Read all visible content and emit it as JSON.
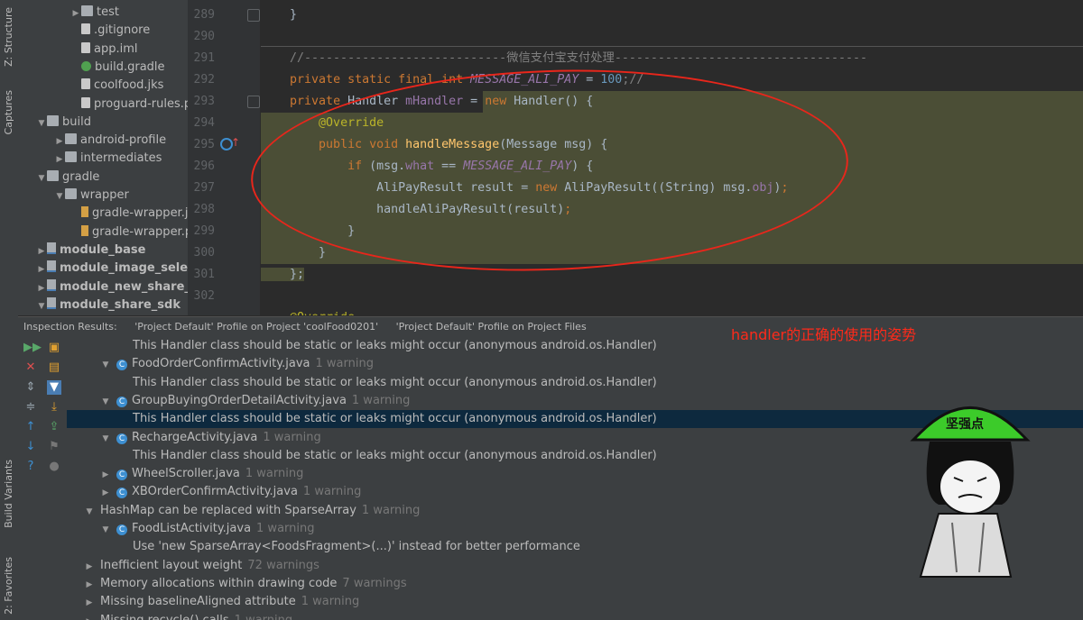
{
  "left_stripe": {
    "structure_tab": "Z: Structure",
    "captures_tab": "Captures",
    "build_variants_tab": "Build Variants",
    "favorites_tab": "2: Favorites"
  },
  "project_tree": [
    {
      "label": "test",
      "type": "folder",
      "arrow": "▶"
    },
    {
      "label": ".gitignore",
      "type": "file",
      "arrow": ""
    },
    {
      "label": "app.iml",
      "type": "file",
      "arrow": ""
    },
    {
      "label": "build.gradle",
      "type": "gradle",
      "arrow": ""
    },
    {
      "label": "coolfood.jks",
      "type": "file",
      "arrow": ""
    },
    {
      "label": "proguard-rules.pro",
      "type": "file",
      "arrow": ""
    },
    {
      "label": "build",
      "type": "folder",
      "arrow": "▼"
    },
    {
      "label": "android-profile",
      "type": "folder",
      "arrow": "▶"
    },
    {
      "label": "intermediates",
      "type": "folder",
      "arrow": "▶"
    },
    {
      "label": "gradle",
      "type": "folder",
      "arrow": "▼"
    },
    {
      "label": "wrapper",
      "type": "folder",
      "arrow": "▼"
    },
    {
      "label": "gradle-wrapper.jar",
      "type": "jar",
      "arrow": ""
    },
    {
      "label": "gradle-wrapper.properties",
      "type": "jar",
      "arrow": ""
    },
    {
      "label": "module_base",
      "type": "module",
      "arrow": "▶"
    },
    {
      "label": "module_image_selector",
      "type": "module",
      "arrow": "▶"
    },
    {
      "label": "module_new_share_sdk",
      "type": "module",
      "arrow": "▶"
    },
    {
      "label": "module_share_sdk",
      "type": "module",
      "arrow": "▼"
    }
  ],
  "editor": {
    "line_numbers": [
      "289",
      "290",
      "291",
      "292",
      "293",
      "294",
      "295",
      "296",
      "297",
      "298",
      "299",
      "300",
      "301",
      "302"
    ],
    "comment_text": "微信支付宝支付处理"
  },
  "inspection": {
    "header_label": "Inspection Results:",
    "tab1": "'Project Default' Profile on Project 'coolFood0201'",
    "tab2": "'Project Default' Profile on Project Files",
    "rows": [
      {
        "indent": 73,
        "arrow": "",
        "icon": false,
        "text": "This Handler class should be static or leaks might occur (anonymous android.os.Handler)",
        "warn": "",
        "selected": false
      },
      {
        "indent": 37,
        "arrow": "▼",
        "icon": true,
        "text": "FoodOrderConfirmActivity.java",
        "warn": "1 warning",
        "selected": false
      },
      {
        "indent": 73,
        "arrow": "",
        "icon": false,
        "text": "This Handler class should be static or leaks might occur (anonymous android.os.Handler)",
        "warn": "",
        "selected": false
      },
      {
        "indent": 37,
        "arrow": "▼",
        "icon": true,
        "text": "GroupBuyingOrderDetailActivity.java",
        "warn": "1 warning",
        "selected": false
      },
      {
        "indent": 73,
        "arrow": "",
        "icon": false,
        "text": "This Handler class should be static or leaks might occur (anonymous android.os.Handler)",
        "warn": "",
        "selected": true
      },
      {
        "indent": 37,
        "arrow": "▼",
        "icon": true,
        "text": "RechargeActivity.java",
        "warn": "1 warning",
        "selected": false
      },
      {
        "indent": 73,
        "arrow": "",
        "icon": false,
        "text": "This Handler class should be static or leaks might occur (anonymous android.os.Handler)",
        "warn": "",
        "selected": false
      },
      {
        "indent": 37,
        "arrow": "▶",
        "icon": true,
        "text": "WheelScroller.java",
        "warn": "1 warning",
        "selected": false
      },
      {
        "indent": 37,
        "arrow": "▶",
        "icon": true,
        "text": "XBOrderConfirmActivity.java",
        "warn": "1 warning",
        "selected": false
      },
      {
        "indent": 19,
        "arrow": "▼",
        "icon": false,
        "text": "HashMap can be replaced with SparseArray",
        "warn": "1 warning",
        "selected": false
      },
      {
        "indent": 37,
        "arrow": "▼",
        "icon": true,
        "text": "FoodListActivity.java",
        "warn": "1 warning",
        "selected": false
      },
      {
        "indent": 73,
        "arrow": "",
        "icon": false,
        "text": "Use 'new SparseArray<FoodsFragment>(...)' instead for better performance",
        "warn": "",
        "selected": false
      },
      {
        "indent": 19,
        "arrow": "▶",
        "icon": false,
        "text": "Inefficient layout weight",
        "warn": "72 warnings",
        "selected": false
      },
      {
        "indent": 19,
        "arrow": "▶",
        "icon": false,
        "text": "Memory allocations within drawing code",
        "warn": "7 warnings",
        "selected": false
      },
      {
        "indent": 19,
        "arrow": "▶",
        "icon": false,
        "text": "Missing baselineAligned attribute",
        "warn": "1 warning",
        "selected": false
      },
      {
        "indent": 19,
        "arrow": "▶",
        "icon": false,
        "text": "Missing recycle() calls",
        "warn": "1 warning",
        "selected": false
      }
    ]
  },
  "overlay": {
    "caption": "handler的正确的使用的姿势",
    "helmet_text": "坚强点"
  },
  "colors": {
    "annotation_red": "#e8261b",
    "selection": "#0d293e",
    "highlight": "#4b4e36"
  }
}
